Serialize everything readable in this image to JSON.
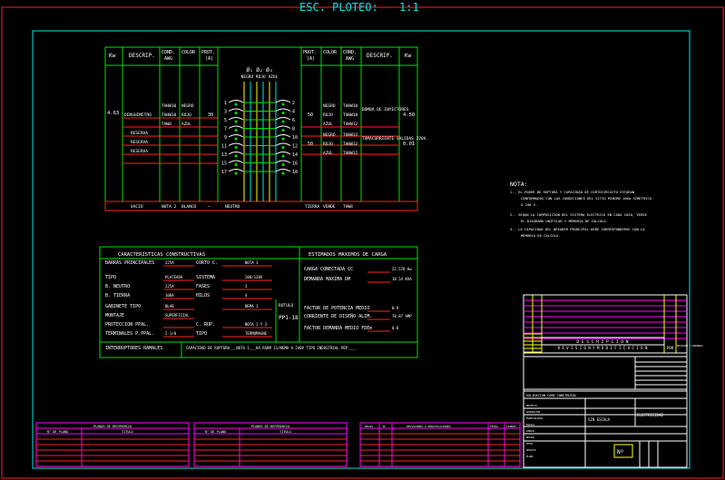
{
  "header": {
    "title": "ESC. PLOTEO:",
    "scale": "1:1"
  },
  "panel": {
    "left_headers": [
      "Kw",
      "DESCRIP.",
      "COND.",
      "AWG",
      "COLOR",
      "PROT.",
      "(A)"
    ],
    "right_headers": [
      "PROT.",
      "(A)",
      "COLOR",
      "COND.",
      "AWG",
      "DESCRIP.",
      "Kw"
    ],
    "phase_top": "Ø₁ Ø₂ Ø₃",
    "phase_colors": "NEGRO ROJO AZUL",
    "left_rows": [
      {
        "kw": "4.63",
        "desc": "DENSHIMETRO",
        "cond": [
          "THHW10",
          "THHW10",
          "THW8"
        ],
        "color": [
          "NEGRO",
          "ROJO",
          "AZUL"
        ],
        "prot": "30"
      },
      {
        "desc": "RESERVA"
      },
      {
        "desc": "RESERVA"
      },
      {
        "desc": "RESERVA"
      }
    ],
    "right_rows": [
      {
        "prot": "50",
        "color": [
          "NEGRO",
          "ROJO",
          "AZUL"
        ],
        "cond": [
          "THHW10",
          "THHW10",
          "THHW12"
        ],
        "desc": "BOMBA DE INYECTORES",
        "kw": "4.50"
      },
      {
        "prot": "50",
        "color": [
          "NEGRO",
          "ROJO",
          "AZUL"
        ],
        "cond": [
          "THHW12",
          "THHW12",
          "THHW12"
        ],
        "desc": "TOMACORRIENTE SALIDAS 220V.",
        "kw": "0.01"
      }
    ],
    "breaker_left_nums": [
      "1",
      "3",
      "5",
      "7",
      "9",
      "11",
      "13",
      "15",
      "17"
    ],
    "breaker_right_nums": [
      "2",
      "4",
      "6",
      "8",
      "10",
      "12",
      "14",
      "16",
      "18"
    ],
    "footer_left": [
      "VACIO",
      "NOTA 2",
      "BLANCO",
      "—",
      "NEUTRO"
    ],
    "footer_right": [
      "TIERRA",
      "—",
      "VERDE",
      "THW8"
    ]
  },
  "notes": {
    "title": "NOTA:",
    "lines": [
      "1.- EL PODER DE RUPTURA Y CAPACIDAD DE CORTOCIRCUITO ESTARAN",
      "CONFORMADOS CON LAS CONDICIONES DEL SITIO MINIMO 10Ka SIMETRICO",
      "A 240 V.",
      "2.- SEGUN LA COMPOSICION DEL SISTEMA ELECTRICO EN CADA CASO, VERSE",
      "EL DIAGRAMA UNIFILAR Y MEMORIA DE CALCULO.",
      "3.- LA CAPACIDAD DEL BREAKER PRINCIPAL DEBE CORRESPONDERSE CON LA",
      "MEMORIA DE CALCULO."
    ]
  },
  "characteristics": {
    "title": "CARACTERISTICAS CONSTRUCTIVAS",
    "rows": [
      {
        "l": "BARRAS PRINCIPALES",
        "v": "225A",
        "l2": "CORTO C.",
        "v2": "NOTA 1"
      },
      {
        "l": "TIPO",
        "v": "PLATEADA",
        "l2": "SISTEMA",
        "v2": "208/120V"
      },
      {
        "l": "B. NEUTRO",
        "v": "225A",
        "l2": "FASES",
        "v2": "3"
      },
      {
        "l": "B. TIERRA",
        "v": "100A",
        "l2": "HILOS",
        "v2": "4"
      },
      {
        "l": "GABINETE TIPO",
        "v": "NLAB",
        "v2": "NEMA 1"
      },
      {
        "l": "MONTAJE",
        "v": "SUPERFICIAL"
      },
      {
        "l": "PROTECCION PPAL.",
        "v": "",
        "l2": "C. RUP.",
        "v2": "NOTA 1 Y 3"
      },
      {
        "l": "TERMINALES P.PPAL.",
        "v": "2-1/0",
        "l2": "TIPO",
        "v2": "TERMOMAGNE"
      }
    ],
    "rotulo_label": "ROTULO",
    "rotulo_value": "PP1-18"
  },
  "loads": {
    "title": "ESTIMADOS MAXIMOS DE CARGA",
    "rows": [
      {
        "l": "CARGA CONECTADA CC",
        "v": "22.570 Kw"
      },
      {
        "l": "DEMANDA MAXIMA DM",
        "v": "18.54 KVA"
      },
      {
        "l": "FACTOR DE POTENCIA MEDIO",
        "v": "0.9"
      },
      {
        "l": "CORRIENTE DE DISEÑO ALIM.",
        "v": "70.87 AMP"
      },
      {
        "l": "FACTOR DEMANDA MEDIO FDEm",
        "v": "0.8"
      }
    ]
  },
  "interrupt_row": {
    "label": "INTERRUPTORES RAMALES",
    "text": "CAPACIDAD DE RUPTURA___NOTA 1___KA RSRM 11/NEMA A 240V TIPO INDUSTRIAL PEP____"
  },
  "bottom_tables": {
    "ref1": {
      "title": "PLANOS DE REFERENCIA",
      "col1": "N° DE PLANO",
      "col2": "TITULO"
    },
    "ref2": {
      "title": "PLANOS DE REFERENCIA",
      "col1": "N° DE PLANO",
      "col2": "TITULO"
    },
    "rev": {
      "cols": [
        "REVIS",
        "N°",
        "REVISIONES O MODIFICACIONES",
        "FECHA",
        "FIRMAS"
      ]
    }
  },
  "title_block": {
    "descripcion": "D E S C R I P C I O N",
    "revision": "R E V I S I O N   Y   M O D I F I C A C I O N",
    "por": "POR",
    "rev_stamp": "REVISADO Y APROBADO",
    "validacion": "VALIDACION COMO CONSTRUIDO",
    "electricidad": "ELECTRICIDAD",
    "sin_escala": "SIN ESCALA",
    "numero": "Nº",
    "small_labels": [
      "PROYECTO",
      "APROBACION",
      "ESPECIALIDAD",
      "ESCALA",
      "DIBUJO",
      "REVISO",
      "FECHA",
      "ARCHIVO",
      "PLANO"
    ]
  }
}
